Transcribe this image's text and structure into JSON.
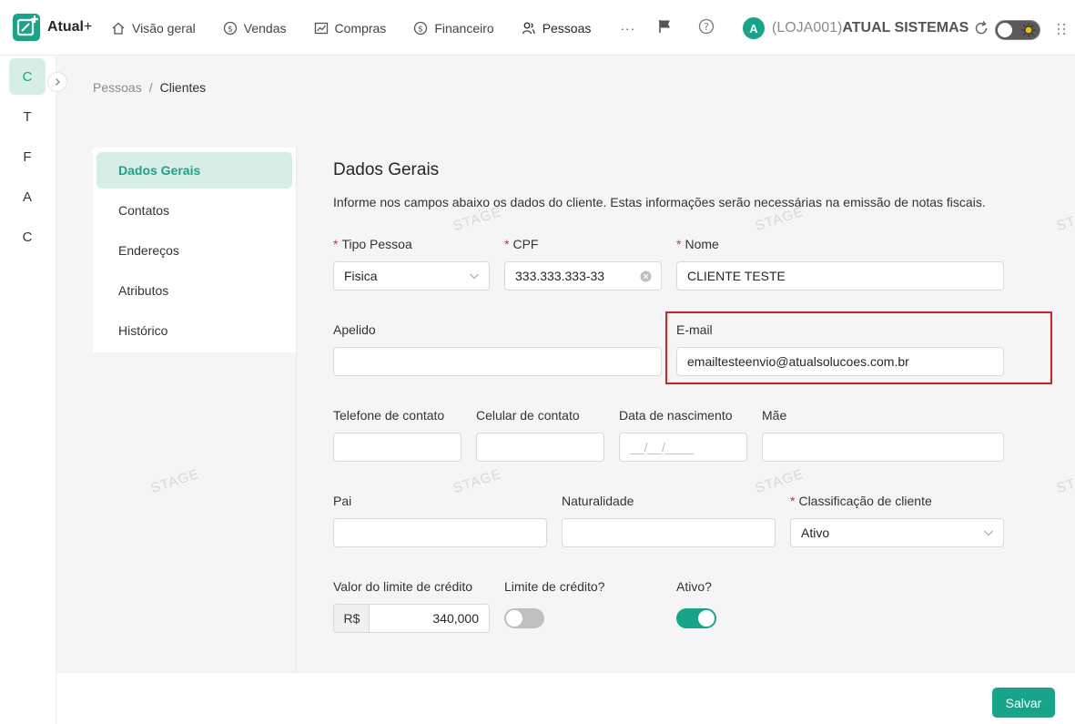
{
  "app": {
    "name": "Atual",
    "plus": "+"
  },
  "nav": [
    {
      "label": "Visão geral",
      "icon": "home-icon"
    },
    {
      "label": "Vendas",
      "icon": "dollar-circle-icon"
    },
    {
      "label": "Compras",
      "icon": "chart-line-icon"
    },
    {
      "label": "Financeiro",
      "icon": "dollar-circle-icon"
    },
    {
      "label": "Pessoas",
      "icon": "users-icon"
    }
  ],
  "nav_more": "···",
  "user": {
    "initial": "A",
    "store": "(LOJA001)",
    "company": "ATUAL SISTEMAS"
  },
  "rail": [
    "C",
    "T",
    "F",
    "A",
    "C"
  ],
  "breadcrumb": {
    "parent": "Pessoas",
    "separator": "/",
    "current": "Clientes"
  },
  "side_menu": [
    "Dados Gerais",
    "Contatos",
    "Endereços",
    "Atributos",
    "Histórico"
  ],
  "form": {
    "title": "Dados Gerais",
    "description": "Informe nos campos abaixo os dados do cliente. Estas informações serão necessárias na emissão de notas fiscais.",
    "tipo_pessoa": {
      "label": "Tipo Pessoa",
      "value": "Fisica"
    },
    "cpf": {
      "label": "CPF",
      "value": "333.333.333-33"
    },
    "nome": {
      "label": "Nome",
      "value": "CLIENTE TESTE"
    },
    "apelido": {
      "label": "Apelido",
      "value": ""
    },
    "email": {
      "label": "E-mail",
      "value": "emailtesteenvio@atualsolucoes.com.br"
    },
    "telefone": {
      "label": "Telefone de contato",
      "value": ""
    },
    "celular": {
      "label": "Celular de contato",
      "value": ""
    },
    "nascimento": {
      "label": "Data de nascimento",
      "placeholder": "__/__/____"
    },
    "mae": {
      "label": "Mãe",
      "value": ""
    },
    "pai": {
      "label": "Pai",
      "value": ""
    },
    "naturalidade": {
      "label": "Naturalidade",
      "value": ""
    },
    "classificacao": {
      "label": "Classificação de cliente",
      "value": "Ativo"
    },
    "limite_valor": {
      "label": "Valor do limite de crédito",
      "prefix": "R$",
      "value": "340,000"
    },
    "limite_credito": {
      "label": "Limite de crédito?",
      "enabled": false
    },
    "ativo": {
      "label": "Ativo?",
      "enabled": true
    }
  },
  "required_mark": "*",
  "save_label": "Salvar",
  "watermark": "STAGE",
  "colors": {
    "accent": "#17a589",
    "required": "#e0282e",
    "highlight": "#d32029"
  }
}
